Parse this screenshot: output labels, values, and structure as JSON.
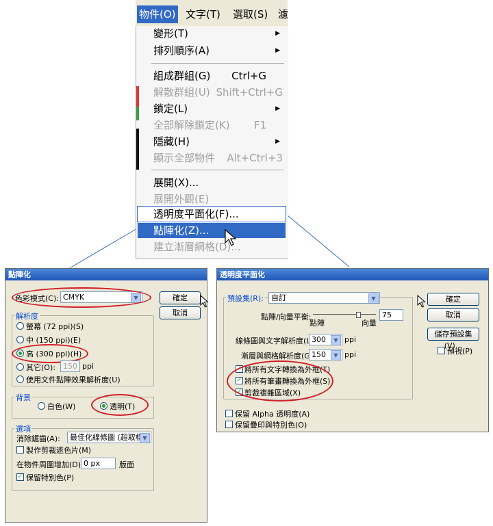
{
  "menubar": {
    "items": [
      "物件(O)",
      "文字(T)",
      "選取(S)",
      "濾"
    ]
  },
  "menu": {
    "items": [
      {
        "label": "變形(T)",
        "submenu": true
      },
      {
        "label": "排列順序(A)",
        "submenu": true
      },
      {
        "label": "組成群組(G)",
        "shortcut": "Ctrl+G"
      },
      {
        "label": "解散群組(U)",
        "shortcut": "Shift+Ctrl+G",
        "disabled": true
      },
      {
        "label": "鎖定(L)",
        "submenu": true
      },
      {
        "label": "全部解除鎖定(K)",
        "shortcut": "F1",
        "disabled": true
      },
      {
        "label": "隱藏(H)",
        "submenu": true
      },
      {
        "label": "顯示全部物件",
        "shortcut": "Alt+Ctrl+3",
        "disabled": true
      },
      {
        "label": "展開(X)..."
      },
      {
        "label": "展開外觀(E)",
        "disabled": true
      },
      {
        "label": "透明度平面化(F)..."
      },
      {
        "label": "點陣化(Z)...",
        "highlighted": true
      },
      {
        "label": "建立漸層網格(D)...",
        "disabled": true
      }
    ]
  },
  "rasterize": {
    "title": "點陣化",
    "color_model_label": "色彩模式(C):",
    "color_model_value": "CMYK",
    "ok": "確定",
    "cancel": "取消",
    "resolution_group": "解析度",
    "res_screen": "螢幕 (72 ppi)(S)",
    "res_medium": "中 (150 ppi)(E)",
    "res_high": "高 (300 ppi)(H)",
    "res_other": "其它(O):",
    "res_other_value": "150",
    "res_other_unit": "ppi",
    "res_use_doc": "使用文件點陣效果解析度(U)",
    "bg_group": "背景",
    "bg_white": "白色(W)",
    "bg_transparent": "透明(T)",
    "options_group": "選項",
    "antialias_label": "消除鋸齒(A):",
    "antialias_value": "最佳化線條圖 (超取樣)",
    "clip_mask": "製作剪裁遮色片(M)",
    "add_around_label": "在物件周圍增加(D):",
    "add_around_value": "0 px",
    "add_around_unit": "版面",
    "keep_spot": "保留特別色(P)"
  },
  "flatten": {
    "title": "透明度平面化",
    "preset_group": "預設集(R):",
    "preset_value": "自訂",
    "ok": "確定",
    "cancel": "取消",
    "save_preset": "儲存預設集(V)...",
    "preview": "預視(P)",
    "balance_label": "點陣/向量平衡:",
    "balance_left": "點陣",
    "balance_right": "向量",
    "balance_value": "75",
    "line_res_label": "線條圖與文字解析度(L):",
    "line_res_value": "300",
    "line_res_unit": "ppi",
    "grad_res_label": "漸層與網格解析度(G):",
    "grad_res_value": "150",
    "grad_res_unit": "ppi",
    "text_outline": "將所有文字轉換為外框(T)",
    "stroke_outline": "將所有筆畫轉換為外框(S)",
    "clip_complex": "剪裁複雜區域(X)",
    "preserve_alpha": "保留 Alpha 透明度(A)",
    "preserve_overprint": "保留疊印與特別色(O)"
  },
  "colors": {
    "highlight": "#316ac5",
    "title_bar": "#2156b8",
    "annotation": "#d0202a"
  }
}
